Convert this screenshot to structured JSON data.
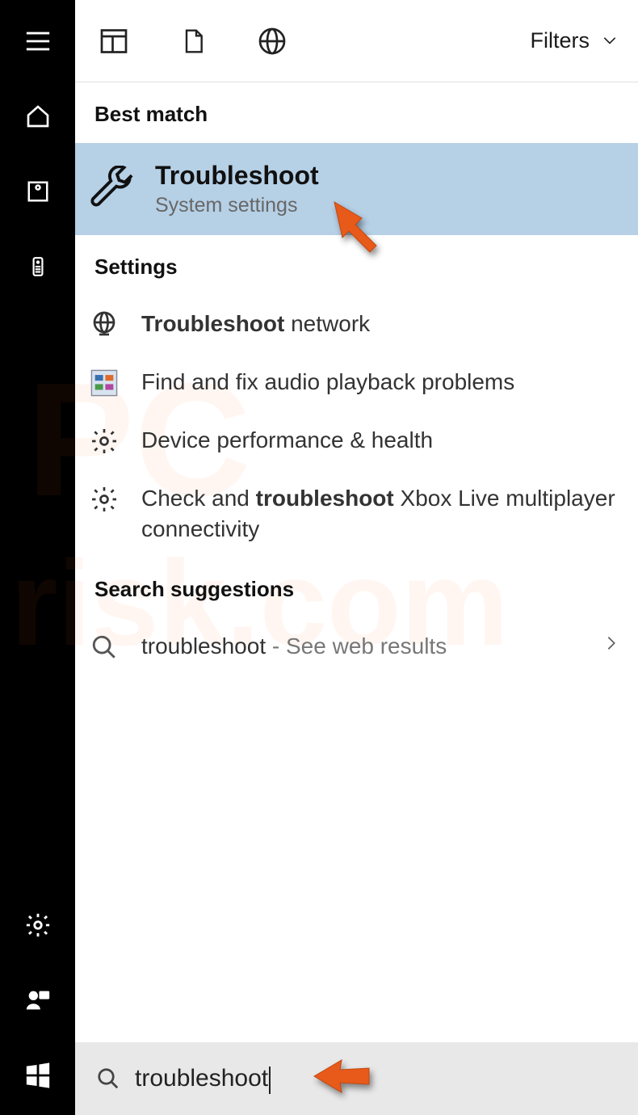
{
  "topbar": {
    "filters_label": "Filters"
  },
  "sections": {
    "best_match": "Best match",
    "settings": "Settings",
    "suggestions": "Search suggestions"
  },
  "best": {
    "title": "Troubleshoot",
    "subtitle": "System settings"
  },
  "settings_items": {
    "i0_bold": "Troubleshoot",
    "i0_rest": " network",
    "i1": "Find and fix audio playback problems",
    "i2": "Device performance & health",
    "i3_a": "Check and ",
    "i3_b": "troubleshoot",
    "i3_c": " Xbox Live multiplayer connectivity"
  },
  "suggestion": {
    "term": "troubleshoot",
    "tail": " - See web results"
  },
  "search": {
    "value": "troubleshoot"
  }
}
